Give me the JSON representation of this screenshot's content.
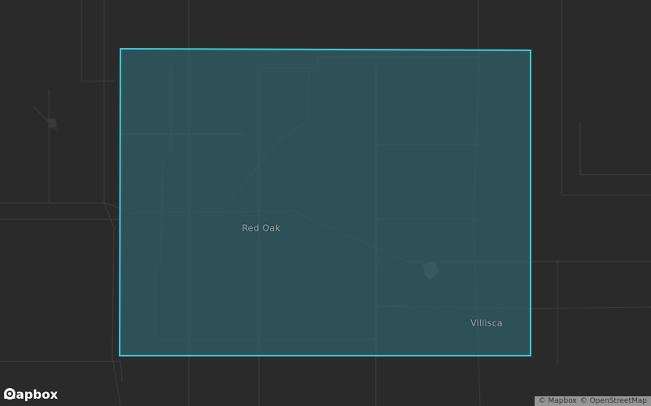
{
  "map": {
    "places": [
      {
        "name": "Red Oak"
      },
      {
        "name": "Villisca"
      }
    ],
    "overlay": {
      "stroke": "#3ec5dc",
      "fill": "#2f5f66"
    },
    "background": "#2a2a2a",
    "road_color": "#3a3a3a"
  },
  "branding": {
    "logo_text": "mapbox",
    "logo_icon": "mapbox-logo-icon"
  },
  "attribution": {
    "mapbox": "© Mapbox",
    "osm": "© OpenStreetMap"
  }
}
